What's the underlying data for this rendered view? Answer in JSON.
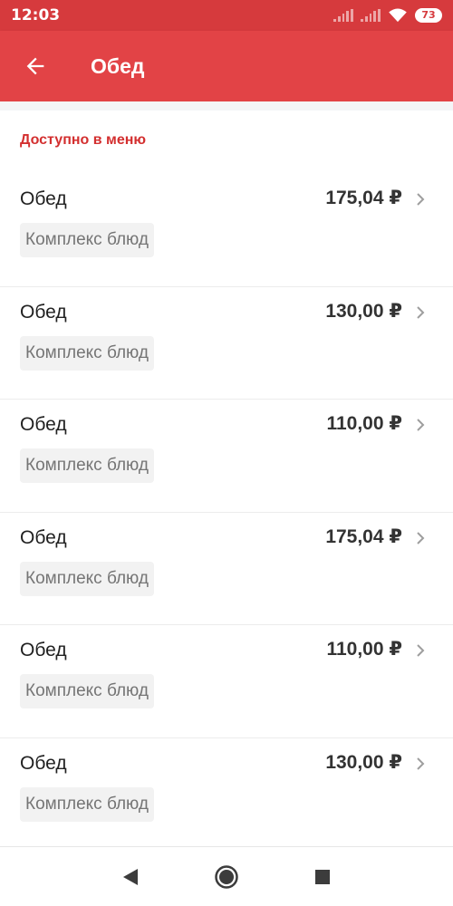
{
  "status_bar": {
    "time": "12:03",
    "battery": "73",
    "icons": [
      "signal-icon",
      "signal-icon",
      "wifi-icon",
      "battery-icon"
    ]
  },
  "app_bar": {
    "back_icon": "arrow-left-icon",
    "title": "Обед"
  },
  "section": {
    "header": "Доступно в меню"
  },
  "menu_items": [
    {
      "name": "Обед",
      "price": "175,04 ₽",
      "tag": "Комплекс блюд"
    },
    {
      "name": "Обед",
      "price": "130,00 ₽",
      "tag": "Комплекс блюд"
    },
    {
      "name": "Обед",
      "price": "110,00 ₽",
      "tag": "Комплекс блюд"
    },
    {
      "name": "Обед",
      "price": "175,04 ₽",
      "tag": "Комплекс блюд"
    },
    {
      "name": "Обед",
      "price": "110,00 ₽",
      "tag": "Комплекс блюд"
    },
    {
      "name": "Обед",
      "price": "130,00 ₽",
      "tag": "Комплекс блюд"
    }
  ],
  "nav_bar": {
    "icons": [
      "back-triangle-icon",
      "home-circle-icon",
      "recents-square-icon"
    ]
  },
  "colors": {
    "status_bar": "#d63a3d",
    "app_bar": "#e24346",
    "section_header": "#d32f2f",
    "tag_background": "#f2f2f2"
  }
}
